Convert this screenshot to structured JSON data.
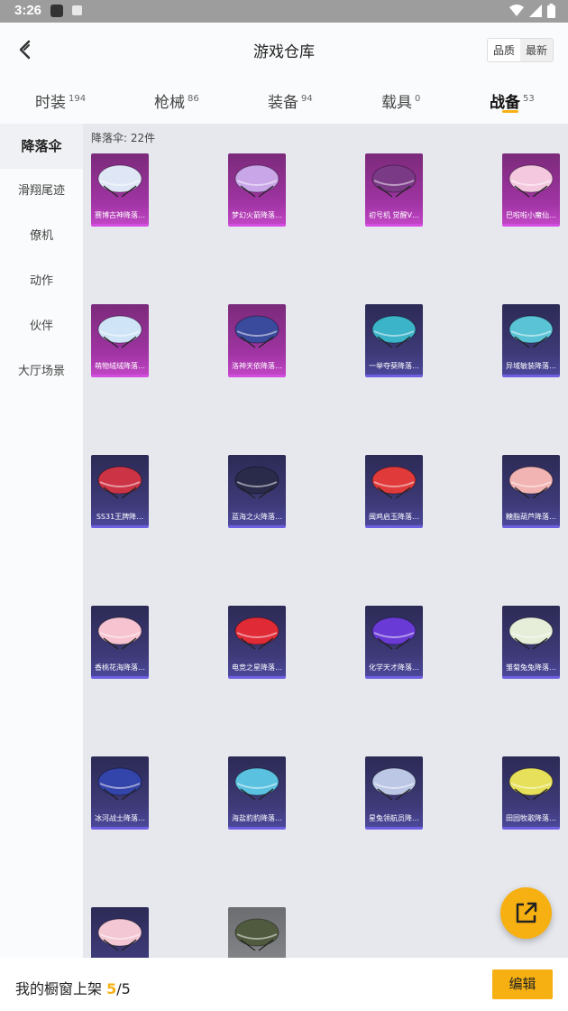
{
  "status": {
    "time": "3:26"
  },
  "header": {
    "title": "游戏仓库",
    "sort_quality": "品质",
    "sort_newest": "最新"
  },
  "tabs": [
    {
      "label": "时装",
      "count": "194"
    },
    {
      "label": "枪械",
      "count": "86"
    },
    {
      "label": "装备",
      "count": "94"
    },
    {
      "label": "载具",
      "count": "0"
    },
    {
      "label": "战备",
      "count": "53"
    }
  ],
  "sidebar": {
    "items": [
      "降落伞",
      "滑翔尾迹",
      "僚机",
      "动作",
      "伙伴",
      "大厅场景"
    ]
  },
  "content": {
    "count_label": "降落伞: 22件",
    "items": [
      {
        "label": "赛博古神降落…",
        "rarity": "pink",
        "color": "#dfe6f5"
      },
      {
        "label": "梦幻火箭降落…",
        "rarity": "pink",
        "color": "#c9a6e8"
      },
      {
        "label": "初号机 觉醒V…",
        "rarity": "pink",
        "color": "#7a3a86"
      },
      {
        "label": "巴啦啦小魔仙…",
        "rarity": "pink",
        "color": "#f4c9df"
      },
      {
        "label": "萌物绒绒降落…",
        "rarity": "pink",
        "color": "#cfe4f6"
      },
      {
        "label": "洛神天依降落…",
        "rarity": "pink",
        "color": "#3a4a9c"
      },
      {
        "label": "一举夺葵降落…",
        "rarity": "purple",
        "color": "#3bb3c8"
      },
      {
        "label": "异域敏装降落…",
        "rarity": "purple",
        "color": "#5ac4d6"
      },
      {
        "label": "SS31王牌降…",
        "rarity": "purple",
        "color": "#cc3344"
      },
      {
        "label": "蓝海之火降落…",
        "rarity": "purple",
        "color": "#2a2a4a"
      },
      {
        "label": "闽鸡启玉降落…",
        "rarity": "purple",
        "color": "#e03a3a"
      },
      {
        "label": "糖脂葫芦降落…",
        "rarity": "purple",
        "color": "#f2b3b3"
      },
      {
        "label": "香桃花海降落…",
        "rarity": "purple",
        "color": "#f7c3d0"
      },
      {
        "label": "电竞之星降落…",
        "rarity": "purple",
        "color": "#e02a36"
      },
      {
        "label": "化学天才降落…",
        "rarity": "purple",
        "color": "#6a3ad6"
      },
      {
        "label": "雏菊兔兔降落…",
        "rarity": "purple",
        "color": "#e6edd8"
      },
      {
        "label": "冰河战士降落…",
        "rarity": "purple",
        "color": "#3344aa"
      },
      {
        "label": "海盐豹豹降落…",
        "rarity": "purple",
        "color": "#5ac2e0"
      },
      {
        "label": "星兔领航员降…",
        "rarity": "purple",
        "color": "#bcc7e6"
      },
      {
        "label": "田园牧歌降落…",
        "rarity": "purple",
        "color": "#e6e05a"
      },
      {
        "label": "",
        "rarity": "purple",
        "color": "#f3c7d4"
      },
      {
        "label": "",
        "rarity": "gray",
        "color": "#4f5a3e"
      }
    ]
  },
  "bottom": {
    "text": "我的橱窗上架",
    "current": "5",
    "total": "5",
    "edit_label": "编辑"
  },
  "colors": {
    "accent": "#f6b012"
  }
}
